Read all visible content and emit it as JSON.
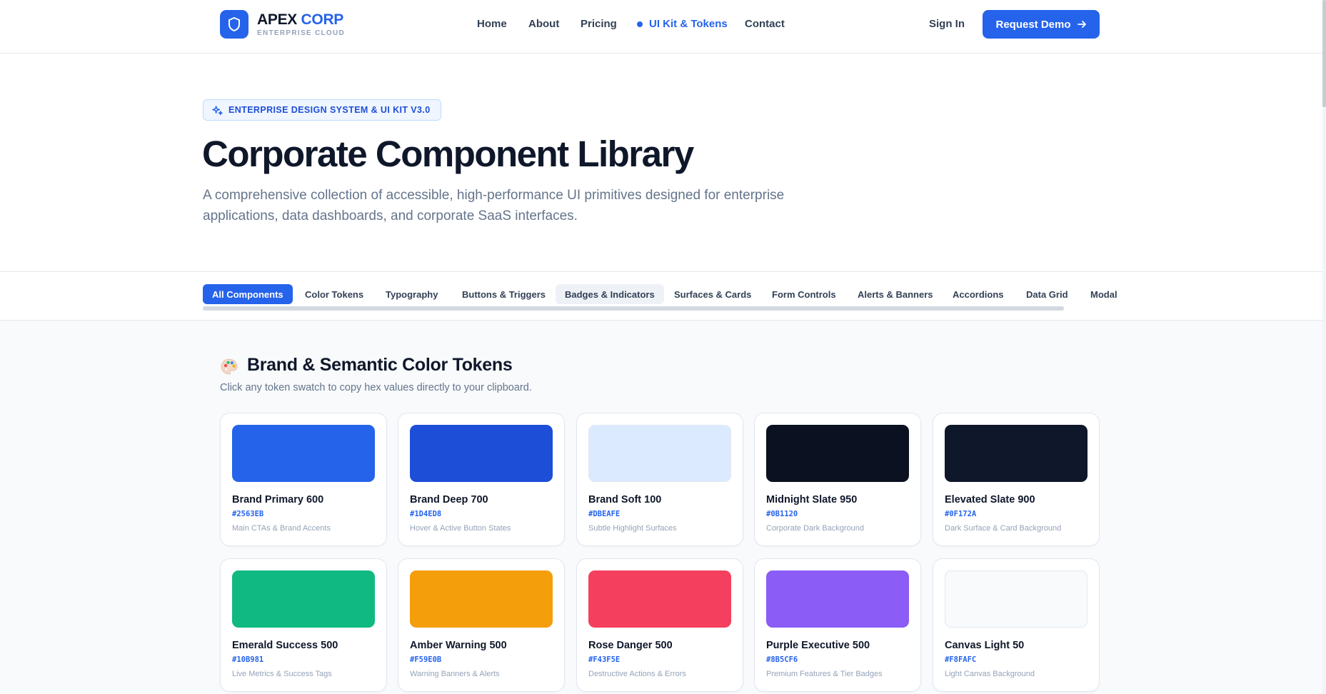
{
  "header": {
    "brand_name": "APEX",
    "brand_accent": "CORP",
    "brand_sub": "ENTERPRISE CLOUD",
    "nav": [
      "Home",
      "About",
      "Pricing",
      "UI Kit & Tokens",
      "Contact"
    ],
    "active_nav": "UI Kit & Tokens",
    "sign_in": "Sign In",
    "demo_button": "Request Demo"
  },
  "hero": {
    "badge": "ENTERPRISE DESIGN SYSTEM & UI KIT V3.0",
    "title": "Corporate Component Library",
    "description": "A comprehensive collection of accessible, high-performance UI primitives designed for enterprise applications, data dashboards, and corporate SaaS interfaces."
  },
  "tabs": [
    "All Components",
    "Color Tokens",
    "Typography",
    "Buttons & Triggers",
    "Badges & Indicators",
    "Surfaces & Cards",
    "Form Controls",
    "Alerts & Banners",
    "Accordions",
    "Data Grid",
    "Modal"
  ],
  "section": {
    "title": "Brand & Semantic Color Tokens",
    "subtitle": "Click any token swatch to copy hex values directly to your clipboard."
  },
  "tokens": [
    {
      "name": "Brand Primary 600",
      "hex": "#2563EB",
      "use": "Main CTAs & Brand Accents"
    },
    {
      "name": "Brand Deep 700",
      "hex": "#1D4ED8",
      "use": "Hover & Active Button States"
    },
    {
      "name": "Brand Soft 100",
      "hex": "#DBEAFE",
      "use": "Subtle Highlight Surfaces"
    },
    {
      "name": "Midnight Slate 950",
      "hex": "#0B1120",
      "use": "Corporate Dark Background"
    },
    {
      "name": "Elevated Slate 900",
      "hex": "#0F172A",
      "use": "Dark Surface & Card Background"
    },
    {
      "name": "Emerald Success 500",
      "hex": "#10B981",
      "use": "Live Metrics & Success Tags"
    },
    {
      "name": "Amber Warning 500",
      "hex": "#F59E0B",
      "use": "Warning Banners & Alerts"
    },
    {
      "name": "Rose Danger 500",
      "hex": "#F43F5E",
      "use": "Destructive Actions & Errors"
    },
    {
      "name": "Purple Executive 500",
      "hex": "#8B5CF6",
      "use": "Premium Features & Tier Badges"
    },
    {
      "name": "Canvas Light 50",
      "hex": "#F8FAFC",
      "use": "Light Canvas Background"
    }
  ],
  "colors": {
    "accent": "#2563eb",
    "text_dark": "#0f172a",
    "muted": "#64748b"
  }
}
